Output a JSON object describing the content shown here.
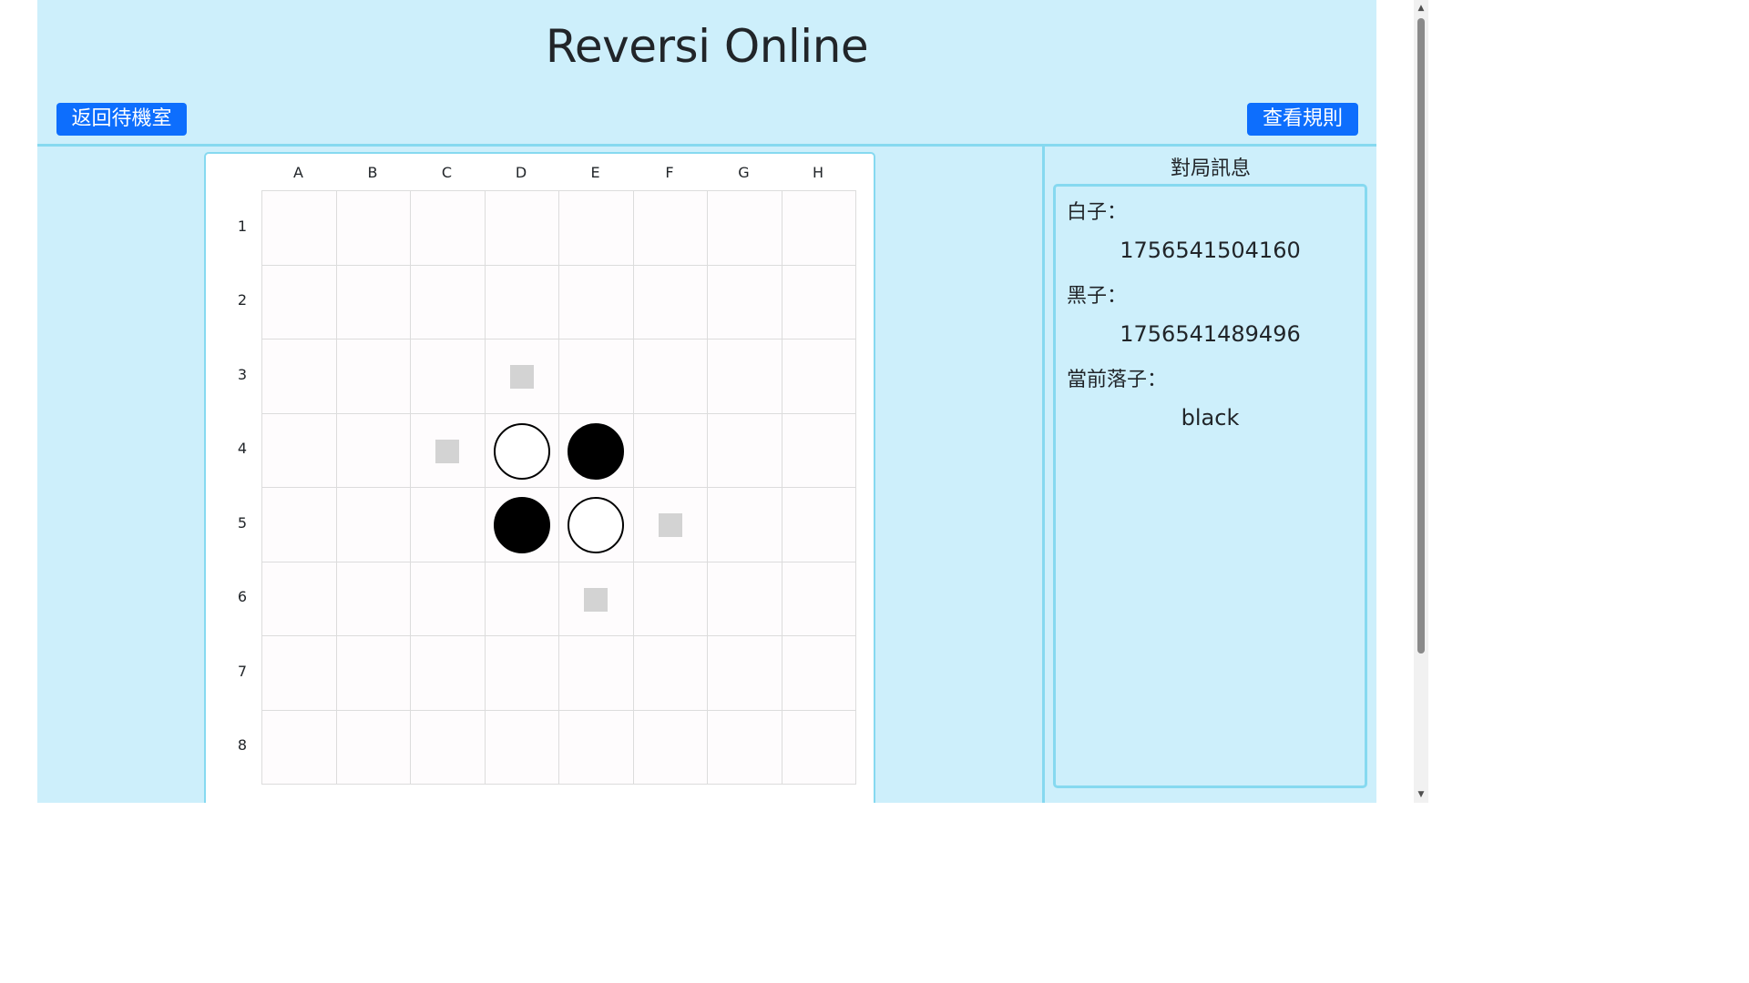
{
  "header": {
    "title": "Reversi Online",
    "back_button": "返回待機室",
    "rules_button": "查看規則"
  },
  "board": {
    "columns": [
      "A",
      "B",
      "C",
      "D",
      "E",
      "F",
      "G",
      "H"
    ],
    "rows": [
      "1",
      "2",
      "3",
      "4",
      "5",
      "6",
      "7",
      "8"
    ],
    "pieces": [
      {
        "cell": "D4",
        "color": "white"
      },
      {
        "cell": "E4",
        "color": "black"
      },
      {
        "cell": "D5",
        "color": "black"
      },
      {
        "cell": "E5",
        "color": "white"
      }
    ],
    "hints": [
      "D3",
      "C4",
      "F5",
      "E6"
    ]
  },
  "info": {
    "heading": "對局訊息",
    "white_label": "白子：",
    "white_player": "1756541504160",
    "black_label": "黑子：",
    "black_player": "1756541489496",
    "current_label": "當前落子：",
    "current_turn": "black"
  },
  "colors": {
    "background": "#cdeffb",
    "accent": "#86d9f0",
    "button": "#0d6efd",
    "hint": "#d3d3d3"
  }
}
